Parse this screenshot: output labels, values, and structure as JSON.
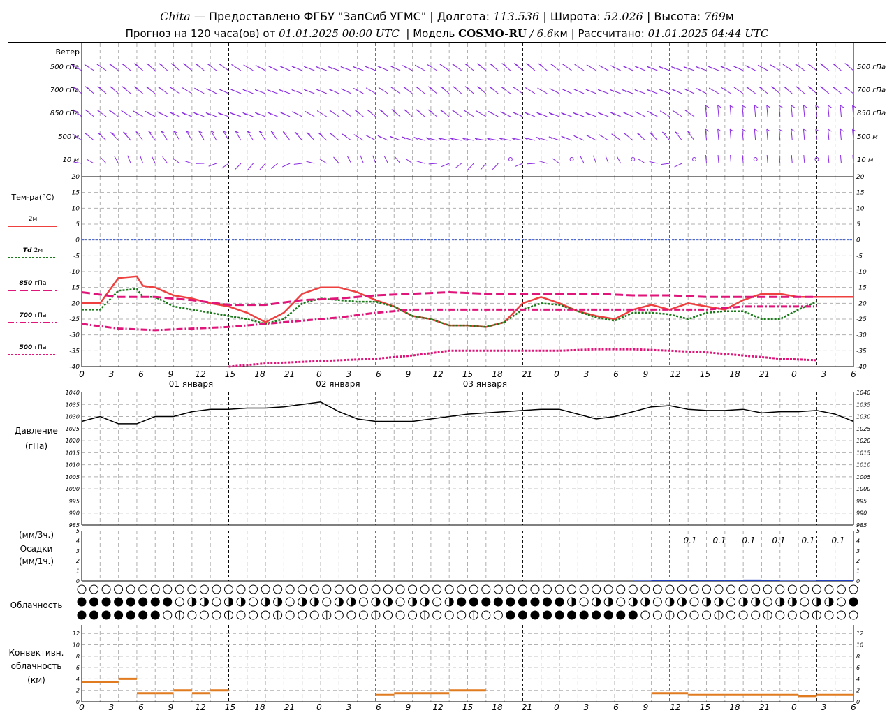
{
  "header": {
    "city": "Chita",
    "provider": "— Предоставлено ФГБУ \"ЗапСиб УГМС\"",
    "lon_label": "Долгота:",
    "lon_value": "113.536",
    "lat_label": "Широта:",
    "lat_value": "52.026",
    "alt_label": "Высота:",
    "alt_value": "769",
    "alt_unit": "м",
    "forecast_label": "Прогноз на 120 часа(ов) от",
    "forecast_date": "01.01.2025 00:00 UTC",
    "model_label": "Модель",
    "model_name": "COSMO-RU",
    "model_res": "/ 6.6",
    "model_res_unit": "км",
    "calc_label": "Рассчитано:",
    "calc_date": "01.01.2025 04:44 UTC"
  },
  "wind_panel": {
    "title": "Ветер",
    "levels": [
      "500 гПа",
      "700 гПа",
      "850 гПа",
      "500 м",
      "10 м"
    ]
  },
  "temp_panel": {
    "title": "Тем-ра(°C)",
    "legend": [
      {
        "label": "2м",
        "italic": "",
        "color": "#ef4040",
        "dash": ""
      },
      {
        "label": "2м",
        "italic": "Td",
        "color": "#1a7a1a",
        "dash": "3,2"
      },
      {
        "label": "гПа",
        "italic": "850",
        "color": "#e0157a",
        "dash": "12,5"
      },
      {
        "label": "гПа",
        "italic": "700",
        "color": "#e0157a",
        "dash": "9,3,2,3"
      },
      {
        "label": "гПа",
        "italic": "500",
        "color": "#e0157a",
        "dash": "3,2"
      }
    ],
    "y_ticks": [
      20,
      15,
      10,
      5,
      0,
      -5,
      -10,
      -15,
      -20,
      -25,
      -30,
      -35,
      -40
    ]
  },
  "x_axis": {
    "hour_labels": [
      "0",
      "3",
      "6",
      "9",
      "12",
      "15",
      "18",
      "21",
      "0",
      "3",
      "6",
      "9",
      "12",
      "15",
      "18",
      "21",
      "0",
      "3",
      "6",
      "9",
      "12",
      "15",
      "18",
      "21",
      "0",
      "3",
      "6"
    ],
    "day_labels": [
      "01 января",
      "02 января",
      "03 января"
    ]
  },
  "pressure_panel": {
    "title": "Давление",
    "unit": "(гПа)",
    "y_ticks": [
      1040,
      1035,
      1030,
      1025,
      1020,
      1015,
      1010,
      1005,
      1000,
      995,
      990,
      985
    ]
  },
  "precip_panel": {
    "unit_3h": "(мм/3ч.)",
    "title": "Осадки",
    "unit_1h": "(мм/1ч.)",
    "y_ticks": [
      5,
      4,
      3,
      2,
      1,
      0
    ],
    "amount_labels": [
      "0.1",
      "0.1",
      "0.1",
      "0.1",
      "0.1",
      "0.1"
    ]
  },
  "cloud_panel": {
    "title": "Облачность"
  },
  "conv_panel": {
    "title_1": "Конвективн.",
    "title_2": "облачность",
    "unit": "(км)",
    "y_ticks": [
      12,
      10,
      8,
      6,
      4,
      2,
      0
    ]
  },
  "colors": {
    "wind": "#8a2be2",
    "t2m": "#ef4040",
    "td2m": "#1a7a1a",
    "upper": "#e0157a",
    "zero_line": "#3b5bd9",
    "pressure": "#000000",
    "precip": "#2040c0",
    "convective": "#e07b20",
    "grid": "#b0b0b0"
  },
  "chart_data": [
    {
      "type": "line",
      "series": [
        {
          "name": "2м",
          "x": [
            0,
            3,
            6,
            9,
            10,
            12,
            15,
            18,
            21,
            24,
            27,
            30,
            33,
            36,
            39,
            42,
            45,
            48,
            51,
            54,
            57,
            60,
            63,
            66,
            69,
            72,
            75,
            78,
            81,
            84,
            87,
            90,
            93,
            96,
            99,
            102,
            105,
            108,
            111,
            114,
            117,
            120,
            123,
            126
          ],
          "values": [
            -20,
            -20,
            -12,
            -11.5,
            -14.5,
            -15,
            -17.5,
            -18.5,
            -20,
            -21,
            -23,
            -26,
            -23,
            -17,
            -15,
            -15,
            -16.5,
            -19,
            -21,
            -24,
            -25,
            -27,
            -27,
            -27.5,
            -26,
            -20,
            -18,
            -20,
            -22.5,
            -24,
            -25,
            -22,
            -20.5,
            -22,
            -20,
            -21,
            -22,
            -19,
            -17,
            -17,
            -18,
            -18,
            -18,
            -18
          ]
        },
        {
          "name": "Td 2м",
          "x": [
            0,
            3,
            6,
            9,
            10,
            12,
            15,
            18,
            21,
            24,
            27,
            30,
            33,
            36,
            39,
            42,
            45,
            48,
            51,
            54,
            57,
            60,
            63,
            66,
            69,
            72,
            75,
            78,
            81,
            84,
            87,
            90,
            93,
            96,
            99,
            102,
            105,
            108,
            111,
            114,
            117,
            120
          ],
          "values": [
            -22,
            -22,
            -16,
            -15.5,
            -18,
            -18,
            -21,
            -22,
            -23,
            -24,
            -25,
            -26.5,
            -25,
            -20,
            -18.5,
            -19,
            -19.5,
            -19.5,
            -21,
            -24,
            -25,
            -27,
            -27,
            -27.5,
            -26,
            -22,
            -20,
            -20.5,
            -22.5,
            -24.5,
            -25.5,
            -23,
            -23,
            -23.5,
            -25,
            -23,
            -22.5,
            -22.5,
            -25,
            -25,
            -22,
            -19.5
          ]
        },
        {
          "name": "850 гПа",
          "x": [
            0,
            6,
            12,
            18,
            24,
            30,
            36,
            42,
            48,
            54,
            60,
            66,
            72,
            78,
            84,
            90,
            96,
            102,
            108,
            114,
            120
          ],
          "values": [
            -16.5,
            -18,
            -18,
            -19,
            -20.5,
            -20.5,
            -19,
            -18.5,
            -17.5,
            -17,
            -16.5,
            -17,
            -17,
            -17,
            -17,
            -17.5,
            -17.5,
            -18,
            -18,
            -18,
            -18
          ]
        },
        {
          "name": "700 гПа",
          "x": [
            0,
            6,
            12,
            18,
            24,
            30,
            36,
            42,
            48,
            54,
            60,
            66,
            72,
            78,
            84,
            90,
            96,
            102,
            108,
            114,
            120
          ],
          "values": [
            -26.5,
            -28,
            -28.5,
            -28,
            -27.5,
            -26.5,
            -25.5,
            -24.5,
            -23,
            -22,
            -22,
            -22,
            -22,
            -22,
            -22,
            -22,
            -22,
            -22,
            -21,
            -21,
            -21
          ]
        },
        {
          "name": "500 гПа",
          "x": [
            24,
            30,
            36,
            42,
            48,
            54,
            60,
            66,
            72,
            78,
            84,
            90,
            96,
            102,
            108,
            114,
            120
          ],
          "values": [
            -40,
            -39,
            -38.5,
            -38,
            -37.5,
            -36.5,
            -35,
            -35,
            -35,
            -35,
            -34.5,
            -34.5,
            -35,
            -35.5,
            -36.5,
            -37.5,
            -38
          ]
        }
      ],
      "xlabel": "",
      "ylabel": "Тем-ра(°C)",
      "xlim": [
        0,
        126
      ],
      "ylim": [
        -40,
        20
      ],
      "grid": true,
      "legend": "left"
    },
    {
      "type": "line",
      "series": [
        {
          "name": "",
          "x": [
            0,
            3,
            6,
            9,
            12,
            15,
            18,
            21,
            24,
            27,
            30,
            33,
            36,
            39,
            42,
            45,
            48,
            51,
            54,
            57,
            60,
            63,
            66,
            69,
            72,
            75,
            78,
            81,
            84,
            87,
            90,
            93,
            96,
            99,
            102,
            105,
            108,
            111,
            114,
            117,
            120,
            123,
            126
          ],
          "values": [
            1028,
            1030,
            1027,
            1027,
            1030,
            1030,
            1032,
            1033,
            1033,
            1033.5,
            1033.5,
            1034,
            1035,
            1036,
            1032,
            1029,
            1028,
            1028,
            1028,
            1029,
            1030,
            1031,
            1031.5,
            1032,
            1032.5,
            1033,
            1033,
            1031,
            1029,
            1030,
            1032,
            1034,
            1034.5,
            1033,
            1032.5,
            1032.5,
            1033,
            1031.5,
            1032,
            1032,
            1032.5,
            1031,
            1028
          ]
        }
      ],
      "xlabel": "",
      "ylabel": "Давление (гПа)",
      "xlim": [
        0,
        126
      ],
      "ylim": [
        985,
        1040
      ],
      "grid": true
    },
    {
      "type": "bar",
      "x": [
        93,
        96,
        99,
        102,
        105,
        108,
        111,
        114,
        117,
        120,
        123,
        126
      ],
      "values": [
        0.05,
        0.1,
        0.1,
        0.1,
        0.1,
        0.1,
        0.15,
        0.1,
        0.05,
        0.05,
        0.1,
        0.1
      ],
      "ylabel": "Осадки",
      "ylim": [
        0,
        5
      ]
    },
    {
      "type": "bar",
      "x": [
        3,
        6,
        9,
        12,
        15,
        18,
        21,
        24,
        51,
        54,
        57,
        60,
        63,
        66,
        96,
        99,
        102,
        105,
        108,
        111,
        114,
        117,
        120,
        123,
        126
      ],
      "values": [
        3.5,
        3.5,
        4,
        1.5,
        1.5,
        2,
        1.5,
        2,
        1.2,
        1.5,
        1.5,
        1.5,
        2,
        2,
        1.5,
        1.5,
        1.2,
        1.2,
        1.2,
        1.2,
        1.2,
        1.2,
        1,
        1.2,
        1.2
      ],
      "ylabel": "Конвективн. облачность (км)",
      "ylim": [
        0,
        12
      ]
    }
  ]
}
